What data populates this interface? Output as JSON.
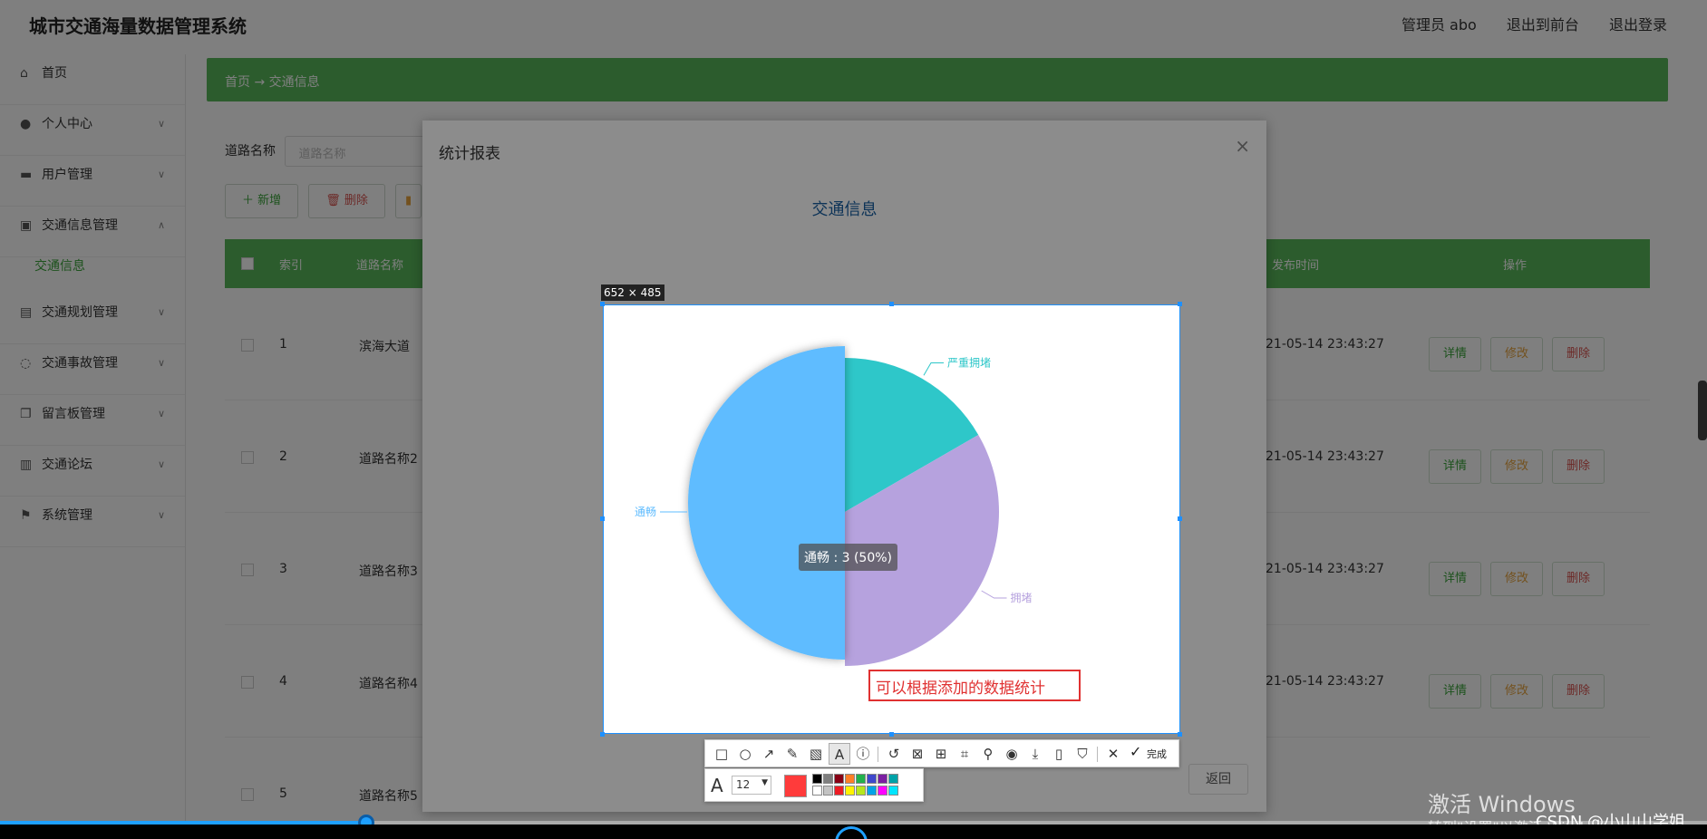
{
  "app": {
    "title": "城市交通海量数据管理系统",
    "admin": "管理员 abo",
    "to_front": "退出到前台",
    "logout": "退出登录"
  },
  "sidebar": {
    "items": [
      {
        "label": "首页",
        "icon": "home-icon"
      },
      {
        "label": "个人中心",
        "icon": "user-icon"
      },
      {
        "label": "用户管理",
        "icon": "users-icon"
      },
      {
        "label": "交通信息管理",
        "icon": "briefcase-icon"
      },
      {
        "label": "交通规划管理",
        "icon": "clipboard-icon"
      },
      {
        "label": "交通事故管理",
        "icon": "power-icon"
      },
      {
        "label": "留言板管理",
        "icon": "copy-icon"
      },
      {
        "label": "交通论坛",
        "icon": "bar-chart-icon"
      },
      {
        "label": "系统管理",
        "icon": "flag-icon"
      }
    ],
    "sub_item": "交通信息"
  },
  "breadcrumb": {
    "home": "首页",
    "sep": "→",
    "current": "交通信息"
  },
  "search": {
    "label": "道路名称",
    "placeholder": "道路名称"
  },
  "toolbar": {
    "add": "新增",
    "delete": "删除"
  },
  "table": {
    "headers": {
      "index": "索引",
      "road": "道路名称",
      "time": "发布时间",
      "ops": "操作"
    },
    "rows": [
      {
        "index": "1",
        "road": "滨海大道",
        "time": "21-05-14 23:43:27"
      },
      {
        "index": "2",
        "road": "道路名称2",
        "time": "21-05-14 23:43:27"
      },
      {
        "index": "3",
        "road": "道路名称3",
        "time": "21-05-14 23:43:27"
      },
      {
        "index": "4",
        "road": "道路名称4",
        "time": "21-05-14 23:43:27"
      },
      {
        "index": "5",
        "road": "道路名称5",
        "time": ""
      }
    ],
    "actions": {
      "detail": "详情",
      "edit": "修改",
      "remove": "删除"
    }
  },
  "modal": {
    "title": "统计报表",
    "close": "×",
    "back": "返回"
  },
  "chart_data": {
    "type": "pie",
    "title": "交通信息",
    "slices": [
      {
        "label": "通畅",
        "value": 3,
        "color": "#5fbcff"
      },
      {
        "label": "严重拥堵",
        "value": 1,
        "color": "#2ec7c9"
      },
      {
        "label": "拥堵",
        "value": 2,
        "color": "#b6a2de"
      }
    ],
    "tooltip": "通畅 : 3 (50%)",
    "colors": {
      "title": "#1a5fa0"
    }
  },
  "capture": {
    "dimensions": "652 × 485",
    "annotation_text": "可以根据添加的数据统计"
  },
  "snip_toolbar": {
    "done": "完成",
    "font_size": "12",
    "current_color": "#ff3b3b",
    "palette": [
      "#000000",
      "#7f7f7f",
      "#880015",
      "#ff7f27",
      "#22b14c",
      "#3f48cc",
      "#7b1fa2",
      "#00a2a8",
      "#ffffff",
      "#c3c3c3",
      "#ed1c24",
      "#fff200",
      "#b5e61d",
      "#00a2e8",
      "#ff00ff",
      "#00e5ff"
    ]
  },
  "video": {
    "progress": 0.21
  },
  "watermark": {
    "windows": "激活 Windows",
    "windows_sub": "转到\"设置\"以激活 Windows。",
    "csdn": "CSDN @小山山学姐"
  }
}
